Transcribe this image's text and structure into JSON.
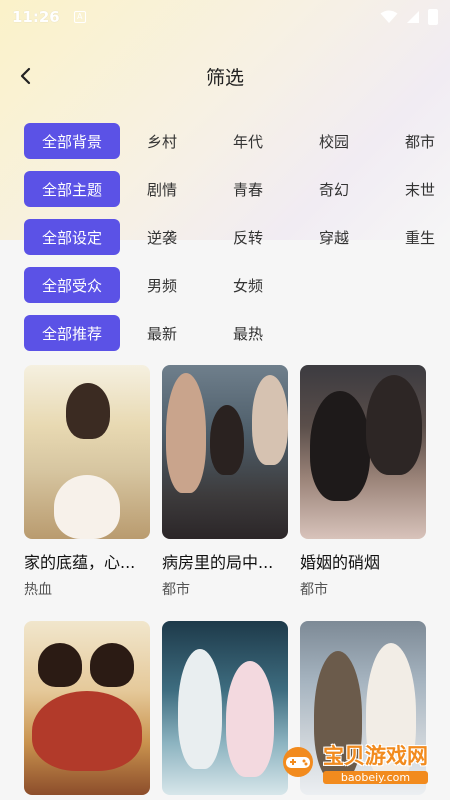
{
  "status_bar": {
    "time": "11:26"
  },
  "header": {
    "title": "筛选"
  },
  "filters": [
    {
      "selected": "全部背景",
      "options": [
        "乡村",
        "年代",
        "校园",
        "都市"
      ]
    },
    {
      "selected": "全部主题",
      "options": [
        "剧情",
        "青春",
        "奇幻",
        "末世"
      ]
    },
    {
      "selected": "全部设定",
      "options": [
        "逆袭",
        "反转",
        "穿越",
        "重生"
      ]
    },
    {
      "selected": "全部受众",
      "options": [
        "男频",
        "女频"
      ]
    },
    {
      "selected": "全部推荐",
      "options": [
        "最新",
        "最热"
      ]
    }
  ],
  "cards": [
    {
      "title": "家的底蕴，心...",
      "tag": "热血",
      "poster_text": ""
    },
    {
      "title": "病房里的局中...",
      "tag": "都市",
      "poster_text": ""
    },
    {
      "title": "婚姻的硝烟",
      "tag": "都市",
      "poster_text": ""
    },
    {
      "title": "",
      "tag": "",
      "poster_text": ""
    },
    {
      "title": "",
      "tag": "",
      "poster_text": ""
    },
    {
      "title": "",
      "tag": "",
      "poster_text": ""
    }
  ],
  "watermark": {
    "name": "宝贝游戏网",
    "url": "baobeiy.com"
  },
  "colors": {
    "accent": "#5b52e6",
    "watermark": "#f28b1e"
  }
}
